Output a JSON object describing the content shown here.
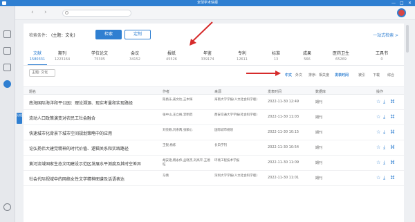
{
  "window": {
    "title": "全球学术快报",
    "controls": [
      "—",
      "□",
      "✕"
    ]
  },
  "nav": {
    "back": "‹",
    "forward": "›",
    "search_placeholder": ""
  },
  "query": {
    "condition_label": "检索条件：",
    "condition_value": "(主题：文化)",
    "search_label": "检索",
    "custom_label": "定制",
    "advanced_label": "一站式检索 >"
  },
  "db_tabs": [
    {
      "name": "文献",
      "count": "1580331"
    },
    {
      "name": "期刊",
      "count": "1223164"
    },
    {
      "name": "学位论文",
      "count": "75305"
    },
    {
      "name": "会议",
      "count": "34152"
    },
    {
      "name": "报纸",
      "count": "45526"
    },
    {
      "name": "年鉴",
      "count": "339174"
    },
    {
      "name": "专利",
      "count": "12611"
    },
    {
      "name": "标准",
      "count": "13"
    },
    {
      "name": "成果",
      "count": "566"
    },
    {
      "name": "医药卫生",
      "count": "65269"
    },
    {
      "name": "工具书",
      "count": "0"
    }
  ],
  "filter_tag": "主题: 文化",
  "sort": {
    "items": [
      "中文",
      "外文",
      "排序:",
      "相关度",
      "发表时间",
      "被引",
      "下载",
      "综合"
    ],
    "active": "发表时间"
  },
  "table": {
    "headers": [
      "题名",
      "作者",
      "来源",
      "发表时间",
      "数据库",
      "操作"
    ],
    "rows": [
      {
        "title": "南海国际海洋和平公园：理论溯源、现实考量和实现路径",
        "author": "陈扬乐,姜文达,王木辉",
        "source": "海南大学学报(人文社会科学版)",
        "date": "2022-11-30 12:49",
        "db": "期刊"
      },
      {
        "title": "流动人口政策演变对农民工社会融合",
        "author": "张中山,王立格,李明范",
        "source": "西安交通大学学报(社会科学版)",
        "date": "2022-11-30 11:03",
        "db": "期刊"
      },
      {
        "title": "快速城市化背景下城市空间规划策略中的应用",
        "author": "刘亮赖,刘余两,张颖心",
        "source": "国际城市规划",
        "date": "2022-11-30 10:15",
        "db": "期刊"
      },
      {
        "title": "论弘扬伟大建党精神的时代价值、逻辑关系和实践路径",
        "author": "王锐,杨栋",
        "source": "长白学刊",
        "date": "2022-11-30 10:54",
        "db": "期刊"
      },
      {
        "title": "黄河流域国家生态文明建设示范区发展水平测度及其时空差异",
        "author": "胡安艳,韩永伟,孟晓杰,刘高平,王德旺",
        "source": "环境工程技术学报",
        "date": "2022-11-30 11:09",
        "db": "期刊"
      },
      {
        "title": "社会代际视域中的网络女性文学精神图谱及话语表达",
        "author": "马倩",
        "source": "深圳大学学报(人文社会科学版)",
        "date": "2022-11-30 11:01",
        "db": "期刊"
      }
    ]
  },
  "side_flag": "分组",
  "colors": {
    "accent": "#2f7fd1",
    "arrow": "#d62b2b"
  }
}
